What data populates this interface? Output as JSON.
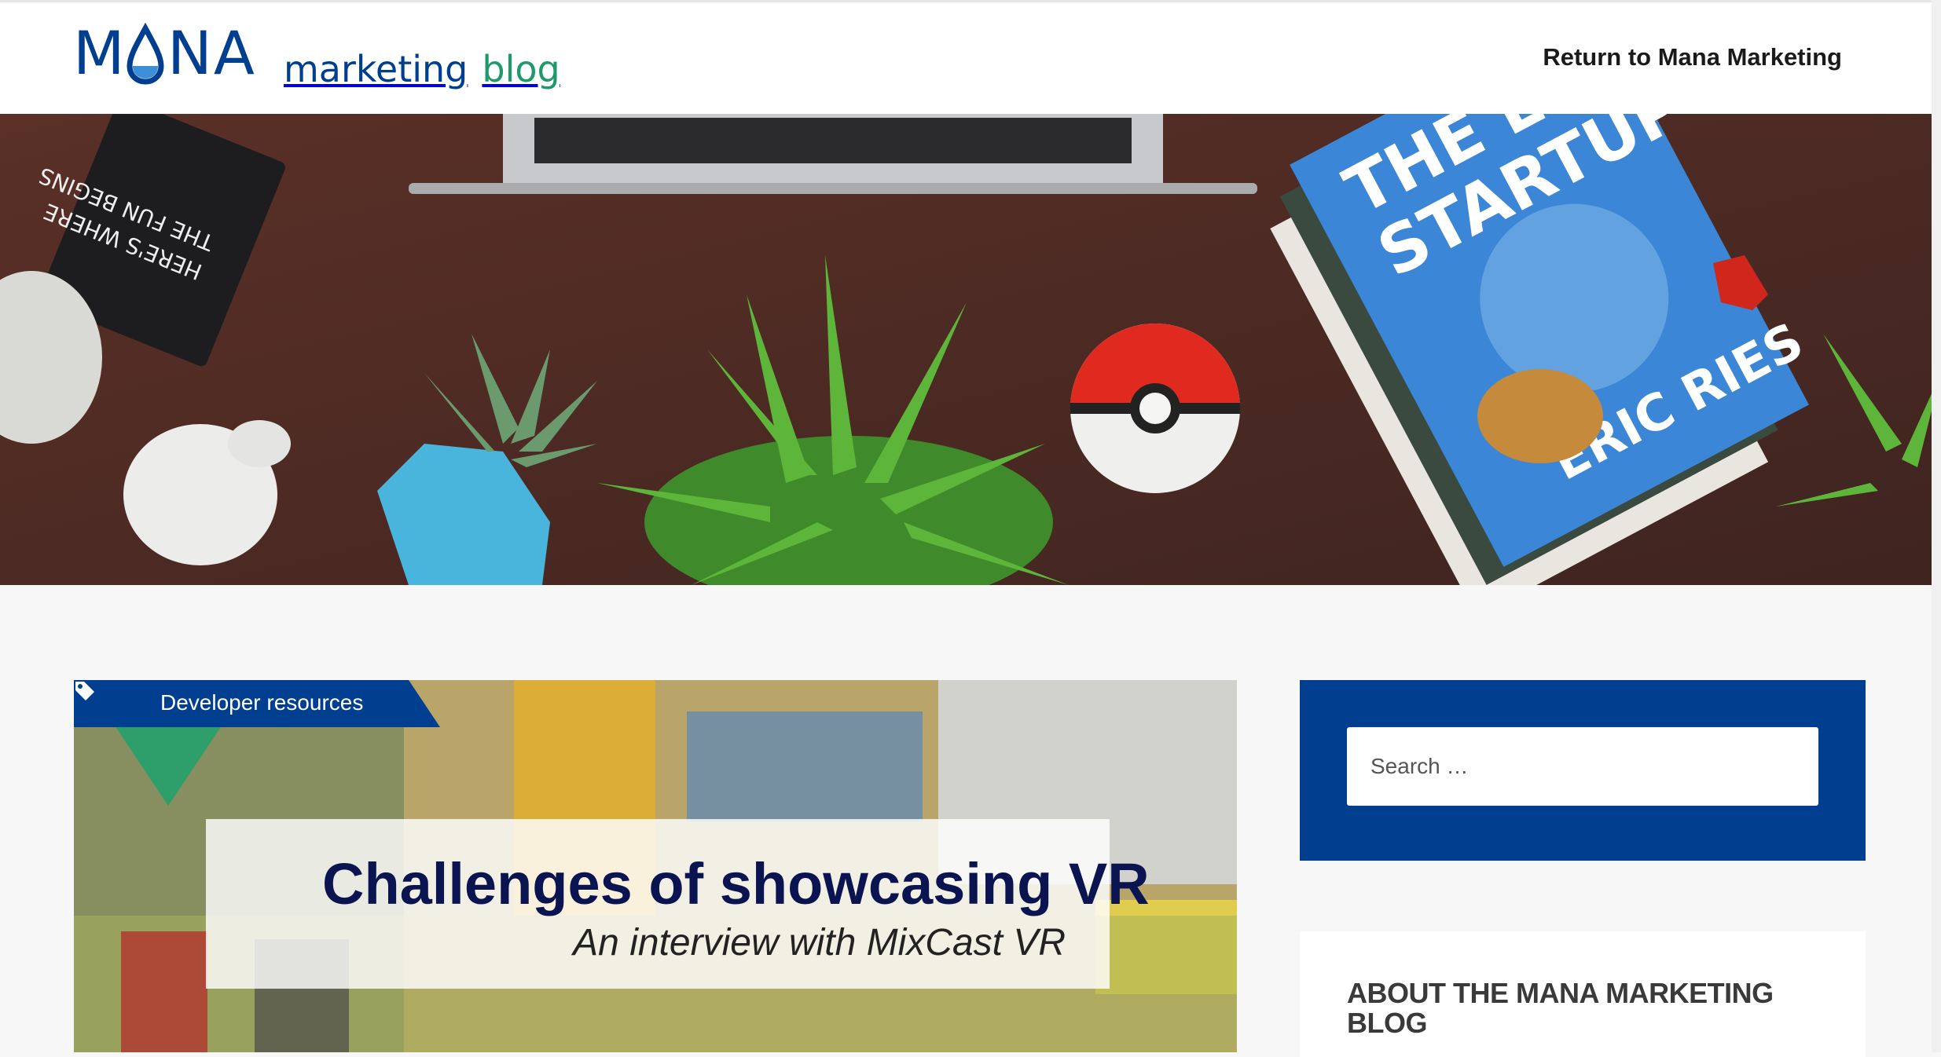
{
  "header": {
    "logo": {
      "mana": "MANA",
      "marketing": "marketing",
      "blog": "blog"
    },
    "return_link": "Return to Mana Marketing"
  },
  "post": {
    "category": "Developer resources",
    "image_title": "Challenges of showcasing VR",
    "image_subtitle": "An interview with MixCast VR"
  },
  "sidebar": {
    "search_placeholder": "Search …",
    "about_title": "ABOUT THE MANA MARKETING BLOG"
  },
  "colors": {
    "brand_blue": "#003f8f",
    "brand_green": "#1e9a6a"
  }
}
